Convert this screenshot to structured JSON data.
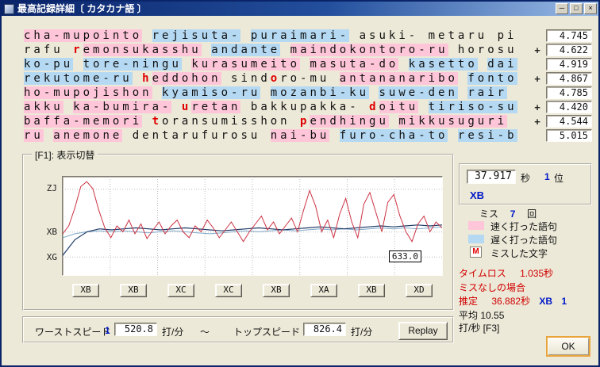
{
  "window": {
    "title": "最高記録詳細〔 カタカナ語 〕"
  },
  "titlebar": {
    "minimize": "─",
    "maximize": "□",
    "close": "×"
  },
  "lines": [
    {
      "plus": false,
      "value": "4.745",
      "segments": [
        {
          "t": "cha-mupointo",
          "s": "fast"
        },
        {
          "t": " ",
          "s": "plain"
        },
        {
          "t": "rejisuta-",
          "s": "slow"
        },
        {
          "t": " ",
          "s": "plain"
        },
        {
          "t": "puraimari-",
          "s": "slow"
        },
        {
          "t": " asuki- metaru pi",
          "s": "plain"
        }
      ]
    },
    {
      "plus": true,
      "value": "4.622",
      "segments": [
        {
          "t": "rafu ",
          "s": "plain"
        },
        {
          "t": "r",
          "s": "miss"
        },
        {
          "t": "emonsukasshu",
          "s": "fast"
        },
        {
          "t": " ",
          "s": "plain"
        },
        {
          "t": "andante",
          "s": "slow"
        },
        {
          "t": " ",
          "s": "plain"
        },
        {
          "t": "maindokontoro-ru",
          "s": "fast"
        },
        {
          "t": " horosu",
          "s": "plain"
        }
      ]
    },
    {
      "plus": false,
      "value": "4.919",
      "segments": [
        {
          "t": "ko-pu",
          "s": "slow"
        },
        {
          "t": " ",
          "s": "plain"
        },
        {
          "t": "tore-ningu",
          "s": "slow"
        },
        {
          "t": " ",
          "s": "plain"
        },
        {
          "t": "kurasumeito",
          "s": "fast"
        },
        {
          "t": " ",
          "s": "plain"
        },
        {
          "t": "masuta-do",
          "s": "fast"
        },
        {
          "t": " ",
          "s": "plain"
        },
        {
          "t": "kasetto",
          "s": "slow"
        },
        {
          "t": " ",
          "s": "plain"
        },
        {
          "t": "dai",
          "s": "slow"
        }
      ]
    },
    {
      "plus": true,
      "value": "4.867",
      "segments": [
        {
          "t": "rekutome-ru",
          "s": "slow"
        },
        {
          "t": " ",
          "s": "plain"
        },
        {
          "t": "h",
          "s": "miss"
        },
        {
          "t": "eddohon",
          "s": "fast"
        },
        {
          "t": " sind",
          "s": "plain"
        },
        {
          "t": "o",
          "s": "miss"
        },
        {
          "t": "ro-mu ",
          "s": "plain"
        },
        {
          "t": "antananaribo",
          "s": "fast"
        },
        {
          "t": " ",
          "s": "plain"
        },
        {
          "t": "fonto",
          "s": "slow"
        }
      ]
    },
    {
      "plus": false,
      "value": "4.785",
      "segments": [
        {
          "t": "ho-mupojishon",
          "s": "fast"
        },
        {
          "t": " ",
          "s": "plain"
        },
        {
          "t": "kyamiso-ru",
          "s": "slow"
        },
        {
          "t": " ",
          "s": "plain"
        },
        {
          "t": "mozanbi-ku",
          "s": "slow"
        },
        {
          "t": " ",
          "s": "plain"
        },
        {
          "t": "suwe-den",
          "s": "slow"
        },
        {
          "t": " ",
          "s": "plain"
        },
        {
          "t": "rair",
          "s": "slow"
        }
      ]
    },
    {
      "plus": true,
      "value": "4.420",
      "segments": [
        {
          "t": "akku",
          "s": "fast"
        },
        {
          "t": " ",
          "s": "plain"
        },
        {
          "t": "ka-bumira-",
          "s": "fast"
        },
        {
          "t": " ",
          "s": "plain"
        },
        {
          "t": "u",
          "s": "miss"
        },
        {
          "t": "retan",
          "s": "fast"
        },
        {
          "t": " bakkupakka- ",
          "s": "plain"
        },
        {
          "t": "d",
          "s": "miss"
        },
        {
          "t": "oitu",
          "s": "fast"
        },
        {
          "t": " ",
          "s": "plain"
        },
        {
          "t": "tiriso-su",
          "s": "slow"
        }
      ]
    },
    {
      "plus": true,
      "value": "4.544",
      "segments": [
        {
          "t": "baffa-memori",
          "s": "fast"
        },
        {
          "t": " ",
          "s": "plain"
        },
        {
          "t": "t",
          "s": "miss"
        },
        {
          "t": "oransumisshon",
          "s": "plain"
        },
        {
          "t": " ",
          "s": "plain"
        },
        {
          "t": "p",
          "s": "miss"
        },
        {
          "t": "endhingu",
          "s": "fast"
        },
        {
          "t": " ",
          "s": "plain"
        },
        {
          "t": "mikkusuguri",
          "s": "fast"
        }
      ]
    },
    {
      "plus": false,
      "value": "5.015",
      "segments": [
        {
          "t": "ru",
          "s": "fast"
        },
        {
          "t": " ",
          "s": "plain"
        },
        {
          "t": "anemone",
          "s": "fast"
        },
        {
          "t": " dentarufurosu ",
          "s": "plain"
        },
        {
          "t": "nai-bu",
          "s": "fast"
        },
        {
          "t": " ",
          "s": "plain"
        },
        {
          "t": "furo-cha-to",
          "s": "slow"
        },
        {
          "t": " ",
          "s": "plain"
        },
        {
          "t": "resi-b",
          "s": "slow"
        }
      ]
    }
  ],
  "chart": {
    "groupbox_label": "[F1]: 表示切替",
    "y_labels": [
      {
        "t": "ZJ",
        "f": 0.127
      },
      {
        "t": "XB",
        "f": 0.563
      },
      {
        "t": "XG",
        "f": 0.817
      }
    ],
    "marker": "633.0",
    "grade_buttons": [
      "XB",
      "XB",
      "XC",
      "XC",
      "XB",
      "XA",
      "XB",
      "XD"
    ],
    "series": {
      "red": [
        0.58,
        0.5,
        0.32,
        0.1,
        0.05,
        0.12,
        0.34,
        0.52,
        0.62,
        0.5,
        0.56,
        0.44,
        0.58,
        0.48,
        0.63,
        0.54,
        0.46,
        0.58,
        0.5,
        0.44,
        0.56,
        0.62,
        0.5,
        0.56,
        0.44,
        0.52,
        0.62,
        0.54,
        0.46,
        0.56,
        0.66,
        0.56,
        0.48,
        0.4,
        0.54,
        0.46,
        0.58,
        0.5,
        0.42,
        0.56,
        0.34,
        0.14,
        0.3,
        0.56,
        0.44,
        0.62,
        0.38,
        0.22,
        0.46,
        0.62,
        0.28,
        0.16,
        0.36,
        0.56,
        0.26,
        0.18,
        0.4,
        0.56,
        0.66,
        0.48,
        0.4,
        0.56,
        0.46,
        0.52
      ],
      "navy": [
        0.8,
        0.64,
        0.56,
        0.53,
        0.54,
        0.53,
        0.52,
        0.53,
        0.54,
        0.53,
        0.52,
        0.53,
        0.54,
        0.55,
        0.54,
        0.53,
        0.52,
        0.53,
        0.54,
        0.53,
        0.52,
        0.51,
        0.52,
        0.53,
        0.52,
        0.51,
        0.5,
        0.51,
        0.5,
        0.49,
        0.5,
        0.49
      ],
      "cyan": [
        0.62,
        0.58,
        0.56,
        0.55,
        0.56,
        0.55,
        0.56,
        0.57,
        0.56,
        0.55,
        0.56,
        0.57,
        0.58,
        0.57,
        0.56,
        0.55,
        0.56,
        0.55,
        0.54,
        0.55,
        0.54,
        0.53,
        0.54,
        0.53,
        0.54,
        0.53,
        0.52,
        0.53,
        0.52,
        0.53,
        0.52,
        0.51
      ]
    }
  },
  "score": {
    "time": "37.917",
    "time_unit": "秒",
    "rank": "1",
    "rank_unit": "位",
    "grade": "XB",
    "miss_label": "ミス",
    "miss_count": "7",
    "miss_unit": "回",
    "timeloss_label": "タイムロス",
    "timeloss_value": "1.035秒",
    "nomiss_label": "ミスなしの場合",
    "est_label": "推定",
    "est_value": "36.882秒",
    "est_grade": "XB",
    "est_rank": "1",
    "avg_line1": "平均 10.55",
    "avg_line2": "打/秒 [F3]"
  },
  "legend": {
    "items": [
      {
        "kind": "fast",
        "label": "速く打った語句"
      },
      {
        "kind": "slow",
        "label": "遅く打った語句"
      },
      {
        "kind": "miss",
        "mark": "M",
        "label": "ミスした文字"
      }
    ]
  },
  "speedbar": {
    "worst_label": "ワーストスピード",
    "worst_rank": "1",
    "worst_value": "520.8",
    "unit1": "打/分",
    "tilde": "～",
    "top_label": "トップスピード",
    "top_value": "826.4",
    "unit2": "打/分",
    "replay": "Replay"
  },
  "buttons": {
    "ok": "OK"
  },
  "colors": {
    "fast": "#ffc6d9",
    "slow": "#b5d9f2",
    "miss": "#e00000",
    "red_text": "#d00000",
    "blue_text": "#0018c8"
  }
}
